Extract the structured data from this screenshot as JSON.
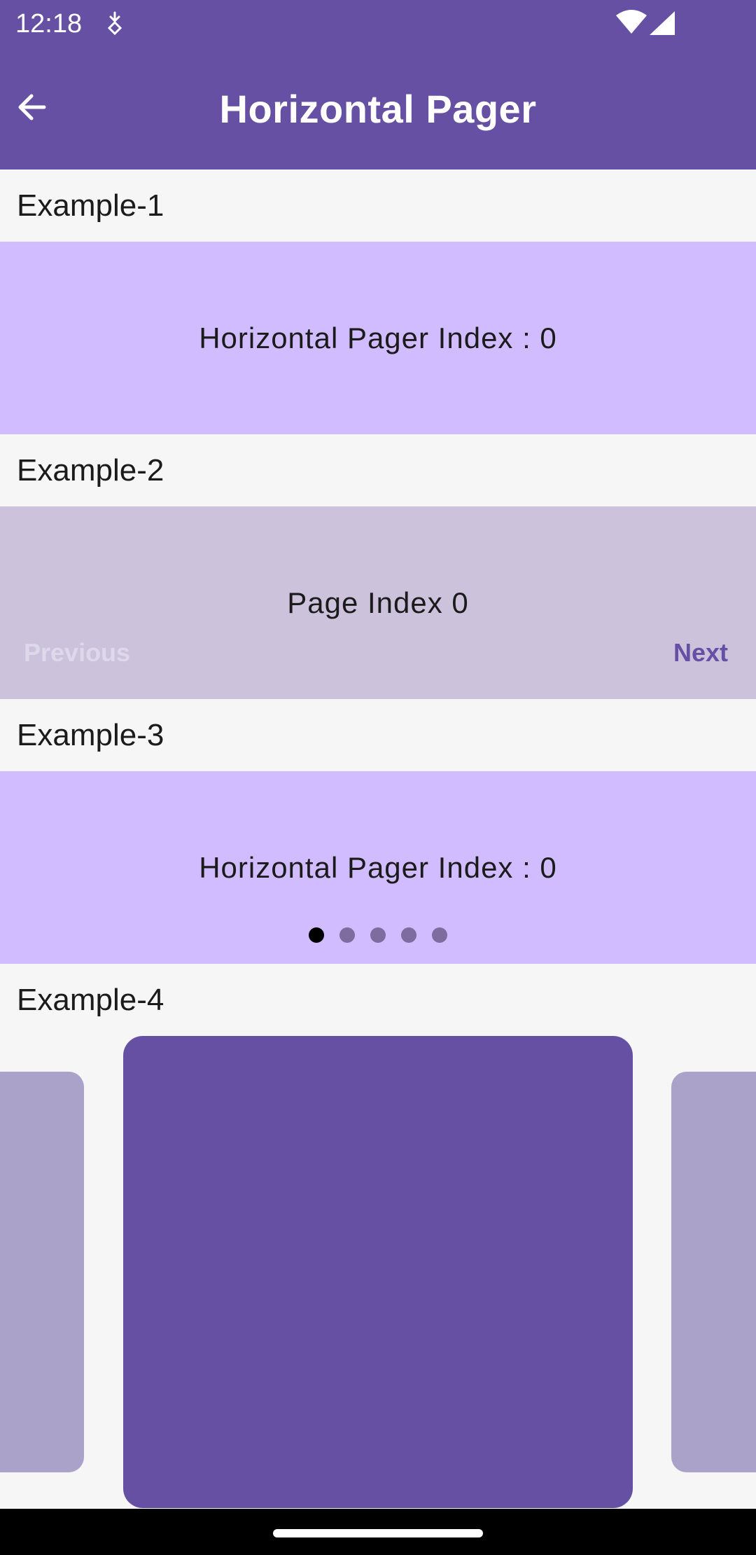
{
  "status_bar": {
    "time": "12:18",
    "icons": [
      "notification-small-icon",
      "wifi-icon",
      "signal-icon"
    ]
  },
  "app_bar": {
    "title": "Horizontal Pager",
    "back_icon": "arrow-left-icon"
  },
  "examples": [
    {
      "label": "Example-1",
      "pager_text": "Horizontal Pager Index : 0"
    },
    {
      "label": "Example-2",
      "pager_text": "Page Index 0",
      "previous_label": "Previous",
      "next_label": "Next"
    },
    {
      "label": "Example-3",
      "pager_text": "Horizontal Pager Index : 0",
      "page_count": 5,
      "active_page": 0
    },
    {
      "label": "Example-4"
    }
  ],
  "colors": {
    "primary": "#6650a4",
    "pager_bg": "#d0bcff",
    "pager_bg_alt": "#ccc2dc",
    "side_card": "#aba2ca",
    "background": "#f6f6f6"
  }
}
